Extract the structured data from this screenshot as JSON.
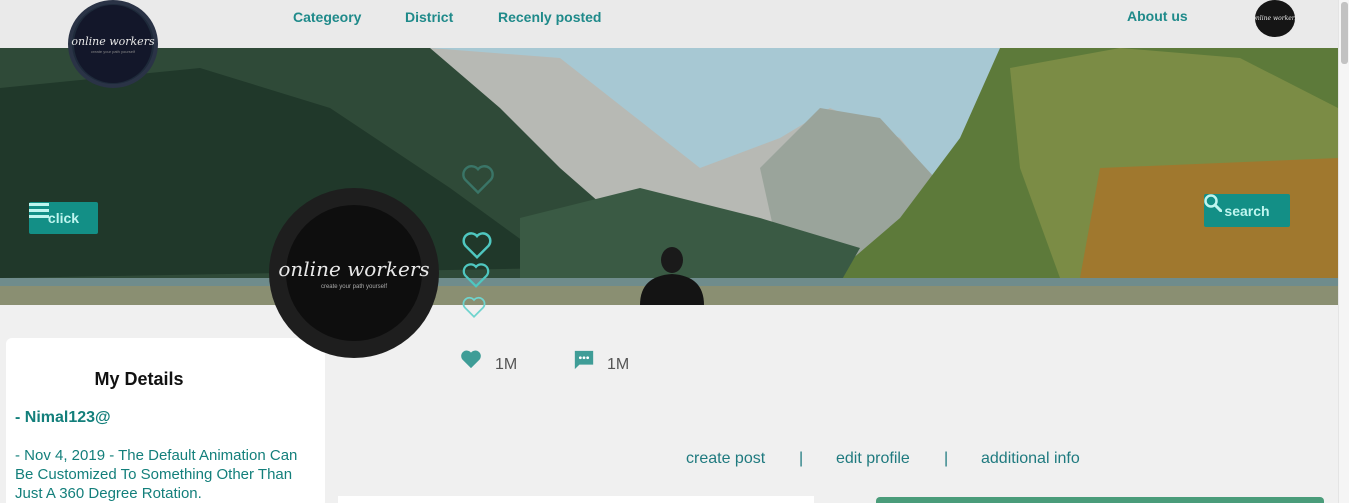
{
  "nav": {
    "links": [
      "Categeory",
      "District",
      "Recenly posted"
    ],
    "about": "About us",
    "logo_text": "online workers",
    "logo_tagline": "create your path yourself"
  },
  "banner": {
    "click_label": "click",
    "search_label": "search"
  },
  "profile": {
    "logo_text": "online workers",
    "logo_tagline": "create your path yourself"
  },
  "stats": {
    "likes": "1M",
    "comments": "1M"
  },
  "details": {
    "title": "My Details",
    "username": "-  Nimal123@",
    "description": "-  Nov 4, 2019 - The Default Animation Can Be Customized To Something Other Than Just A 360 Degree Rotation."
  },
  "actions": {
    "create_post": "create post",
    "edit_profile": "edit profile",
    "additional_info": "additional info",
    "separator": "|"
  },
  "colors": {
    "accent": "#138f86",
    "link": "#1f8a8a",
    "heart": "#4fc7c0"
  }
}
